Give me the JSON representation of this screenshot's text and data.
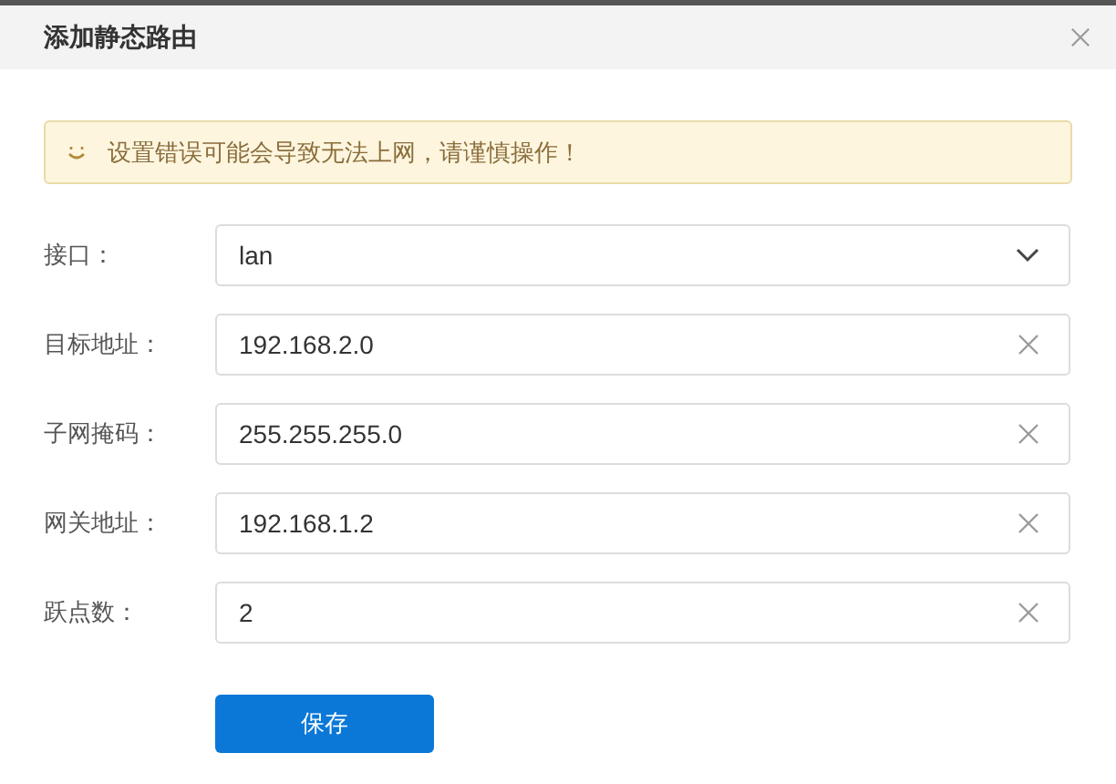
{
  "dialog": {
    "title": "添加静态路由",
    "notice": "设置错误可能会导致无法上网，请谨慎操作！",
    "fields": [
      {
        "label": "接口：",
        "kind": "select",
        "value": "lan"
      },
      {
        "label": "目标地址：",
        "kind": "text",
        "value": "192.168.2.0"
      },
      {
        "label": "子网掩码：",
        "kind": "text",
        "value": "255.255.255.0"
      },
      {
        "label": "网关地址：",
        "kind": "text",
        "value": "192.168.1.2"
      },
      {
        "label": "跃点数：",
        "kind": "text",
        "value": "2"
      }
    ],
    "save_button": "保存"
  }
}
